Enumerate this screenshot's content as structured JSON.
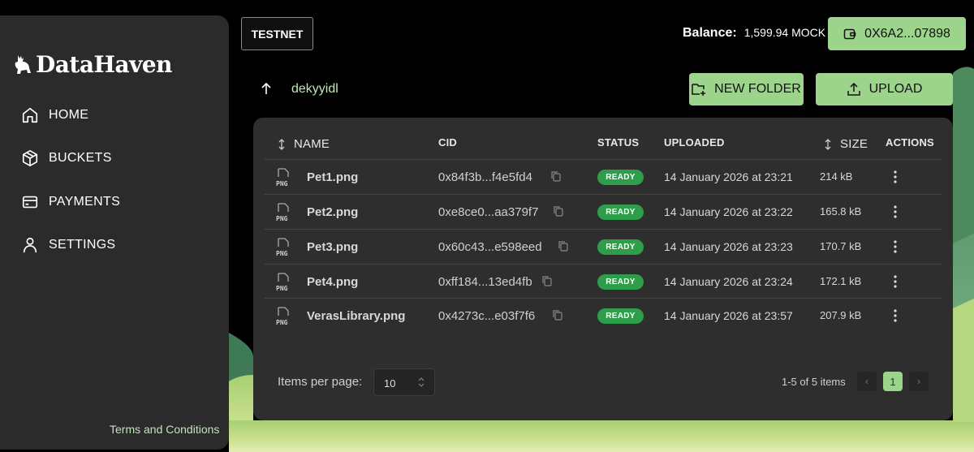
{
  "brand": {
    "name": "DataHaven",
    "logo_icon": "deer-logo-icon"
  },
  "sidebar": {
    "items": [
      {
        "label": "HOME",
        "icon": "home-icon"
      },
      {
        "label": "BUCKETS",
        "icon": "box-icon"
      },
      {
        "label": "PAYMENTS",
        "icon": "credit-card-icon"
      },
      {
        "label": "SETTINGS",
        "icon": "user-icon"
      }
    ],
    "terms_link": "Terms and Conditions"
  },
  "topbar": {
    "network": "TESTNET",
    "balance_label": "Balance:",
    "balance_value": "1,599.94 MOCK",
    "wallet_address": "0X6A2...07898"
  },
  "path": {
    "bucket": "dekyyidl"
  },
  "actions": {
    "new_folder": "NEW FOLDER",
    "upload": "UPLOAD"
  },
  "table": {
    "columns": {
      "name": "NAME",
      "cid": "CID",
      "status": "STATUS",
      "uploaded": "UPLOADED",
      "size": "SIZE",
      "actions": "ACTIONS"
    },
    "file_type_label": "PNG",
    "rows": [
      {
        "name": "Pet1.png",
        "cid": "0x84f3b...f4e5fd4",
        "status": "READY",
        "uploaded": "14 January 2026 at 23:21",
        "size": "214 kB"
      },
      {
        "name": "Pet2.png",
        "cid": "0xe8ce0...aa379f7",
        "status": "READY",
        "uploaded": "14 January 2026 at 23:22",
        "size": "165.8 kB"
      },
      {
        "name": "Pet3.png",
        "cid": "0x60c43...e598eed",
        "status": "READY",
        "uploaded": "14 January 2026 at 23:23",
        "size": "170.7 kB"
      },
      {
        "name": "Pet4.png",
        "cid": "0xff184...13ed4fb",
        "status": "READY",
        "uploaded": "14 January 2026 at 23:24",
        "size": "172.1 kB"
      },
      {
        "name": "VerasLibrary.png",
        "cid": "0x4273c...e03f7f6",
        "status": "READY",
        "uploaded": "14 January 2026 at 23:57",
        "size": "207.9 kB"
      }
    ]
  },
  "pagination": {
    "items_per_page_label": "Items per page:",
    "items_per_page": "10",
    "range_text": "1-5 of 5 items",
    "current_page": "1"
  },
  "colors": {
    "accent": "#9cd48c",
    "ready": "#2e9e4a",
    "card": "#2e2e2e",
    "sidebar": "#2b2b2b"
  }
}
